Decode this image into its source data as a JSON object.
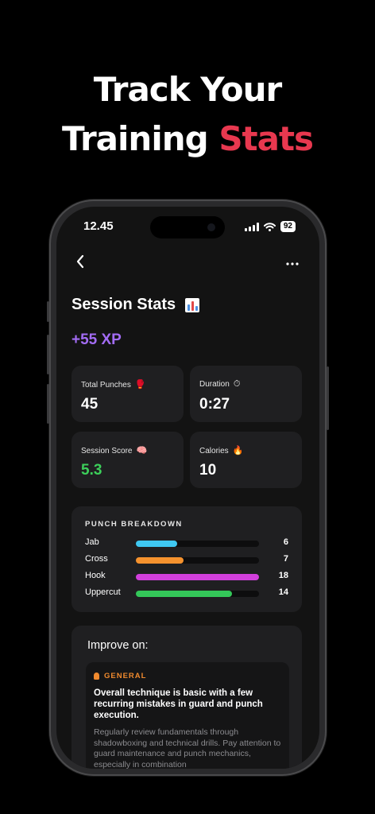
{
  "headline": {
    "line1": "Track Your",
    "line2_plain": "Training ",
    "line2_accent": "Stats"
  },
  "status": {
    "time": "12.45",
    "battery": "92"
  },
  "nav": {
    "back_icon": "chevron-left-icon",
    "more_icon": "more-horizontal-icon"
  },
  "page": {
    "title": "Session Stats"
  },
  "xp": "+55 XP",
  "stats": [
    {
      "label": "Total Punches",
      "icon": "boxing-glove-icon",
      "emoji": "🥊",
      "value": "45"
    },
    {
      "label": "Duration",
      "icon": "stopwatch-icon",
      "emoji": "⏱",
      "value": "0:27"
    },
    {
      "label": "Session Score",
      "icon": "brain-icon",
      "emoji": "🧠",
      "value": "5.3"
    },
    {
      "label": "Calories",
      "icon": "fire-icon",
      "emoji": "🔥",
      "value": "10"
    }
  ],
  "breakdown": {
    "title": "PUNCH BREAKDOWN",
    "max": 18,
    "rows": [
      {
        "name": "Jab",
        "count": 6,
        "count_text": "6",
        "color": "#3fc8f2"
      },
      {
        "name": "Cross",
        "count": 7,
        "count_text": "7",
        "color": "#f5922e"
      },
      {
        "name": "Hook",
        "count": 18,
        "count_text": "18",
        "color": "#d23fdc"
      },
      {
        "name": "Uppercut",
        "count": 14,
        "count_text": "14",
        "color": "#34c759"
      }
    ]
  },
  "improve": {
    "title": "Improve on:",
    "tip": {
      "category": "GENERAL",
      "headline": "Overall technique is basic with a few recurring mistakes in guard and punch execution.",
      "body": "Regularly review fundamentals through shadowboxing and technical drills. Pay attention to guard maintenance and punch mechanics, especially in combination"
    }
  },
  "colors": {
    "accent": "#e8384f",
    "xp": "#a36cf5",
    "score": "#3ccf5a",
    "tip_category": "#f08a2e"
  }
}
